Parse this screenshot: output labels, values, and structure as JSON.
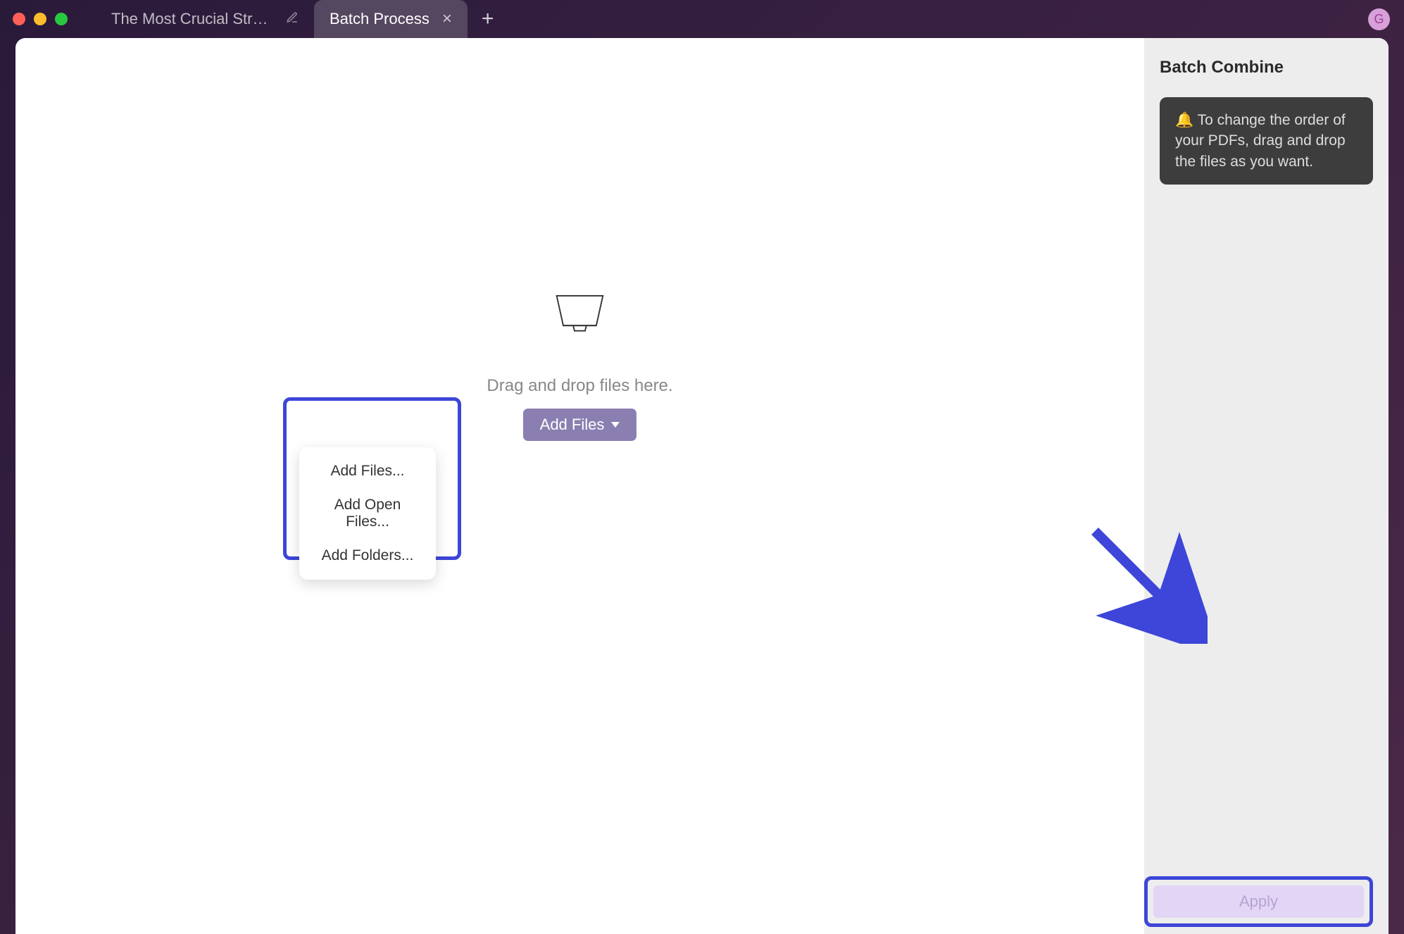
{
  "window": {
    "avatar_initial": "G"
  },
  "tabs": {
    "inactive": {
      "title": "The Most Crucial Strategy"
    },
    "active": {
      "title": "Batch Process"
    }
  },
  "main": {
    "drop_text": "Drag and drop files here.",
    "add_files_button": "Add Files",
    "dropdown": {
      "add_files": "Add Files...",
      "add_open_files": "Add Open Files...",
      "add_folders": "Add Folders..."
    }
  },
  "sidebar": {
    "title": "Batch Combine",
    "info": "🔔 To change the order of your PDFs, drag and drop the files as you want.",
    "apply_button": "Apply"
  }
}
